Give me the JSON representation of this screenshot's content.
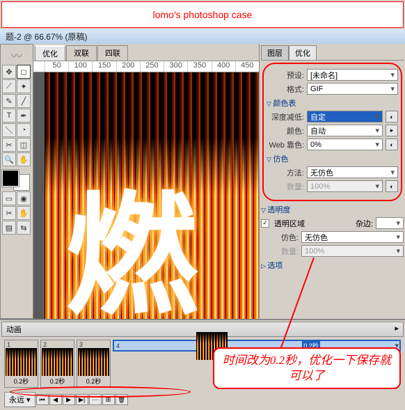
{
  "watermark": "lomo's photoshop case",
  "title": "题-2 @ 66.67% (原稿)",
  "doc_tabs": [
    "优化",
    "双联",
    "四联"
  ],
  "ruler": [
    "50",
    "100",
    "150",
    "200",
    "250",
    "300",
    "350",
    "400",
    "450"
  ],
  "fire_char": "燃",
  "panel_tabs": [
    "图层",
    "优化"
  ],
  "opt": {
    "preset_lbl": "预设:",
    "preset_val": "[未命名]",
    "format_lbl": "格式:",
    "format_val": "GIF",
    "color_table": "颜色表",
    "depth_lbl": "深度减低:",
    "depth_val": "自定",
    "color_lbl": "颜色:",
    "color_val": "自动",
    "web_lbl": "Web 靠色:",
    "web_val": "0%",
    "dither": "仿色",
    "method_lbl": "方法:",
    "method_val": "无仿色",
    "amount_lbl": "数量:",
    "amount_val": "100%",
    "trans": "透明度",
    "trans_area": "透明区域",
    "matte_lbl": "杂边:",
    "tdither_lbl": "仿色:",
    "tdither_val": "无仿色",
    "tamt_lbl": "数量:",
    "tamt_val": "100%",
    "options": "选项"
  },
  "anim": {
    "title": "动画",
    "frames": [
      {
        "n": "1",
        "t": "0.2秒"
      },
      {
        "n": "2",
        "t": "0.2秒"
      },
      {
        "n": "3",
        "t": "0.2秒"
      },
      {
        "n": "4",
        "t": "0.2秒"
      }
    ],
    "forever": "永远"
  },
  "callout": "时间改为0.2秒，优化一下保存就可以了"
}
